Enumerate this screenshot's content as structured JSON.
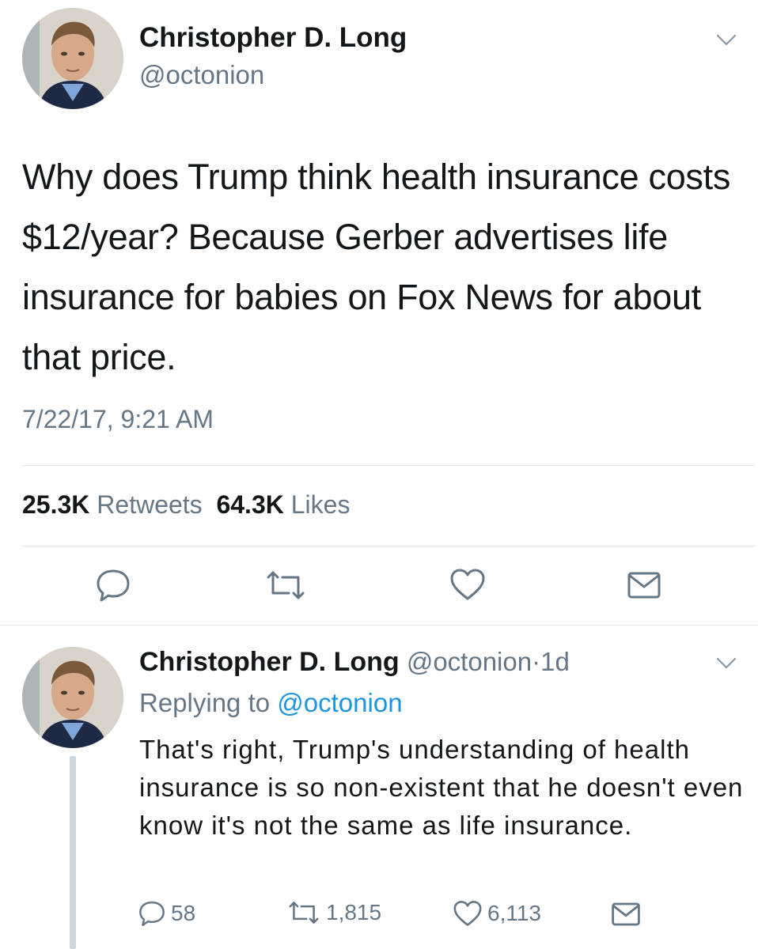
{
  "main_tweet": {
    "author_name": "Christopher D. Long",
    "author_handle": "@octonion",
    "text": "Why does Trump think health insurance costs $12/year? Because Gerber advertises life insurance for babies on Fox News for about that price.",
    "timestamp": "7/22/17, 9:21 AM",
    "retweets_count": "25.3K",
    "retweets_label": "Retweets",
    "likes_count": "64.3K",
    "likes_label": "Likes",
    "icons": [
      "reply-icon",
      "retweet-icon",
      "like-icon",
      "direct-message-icon",
      "chevron-down-icon"
    ]
  },
  "reply_tweet": {
    "author_name": "Christopher D. Long",
    "author_handle": "@octonion",
    "separator": "·",
    "age": "1d",
    "replying_label": "Replying to",
    "replying_to": "@octonion",
    "text": "That's right, Trump's understanding of health insurance is so non-existent that he doesn't even know it's not the same as life insurance.",
    "reply_count": "58",
    "retweet_count": "1,815",
    "like_count": "6,113",
    "icons": [
      "reply-icon",
      "retweet-icon",
      "like-icon",
      "direct-message-icon",
      "chevron-down-icon"
    ]
  },
  "colors": {
    "text": "#14171a",
    "secondary": "#657786",
    "link": "#1b95e0",
    "divider": "#e1e8ed",
    "thread_line": "#ccd6dd"
  }
}
